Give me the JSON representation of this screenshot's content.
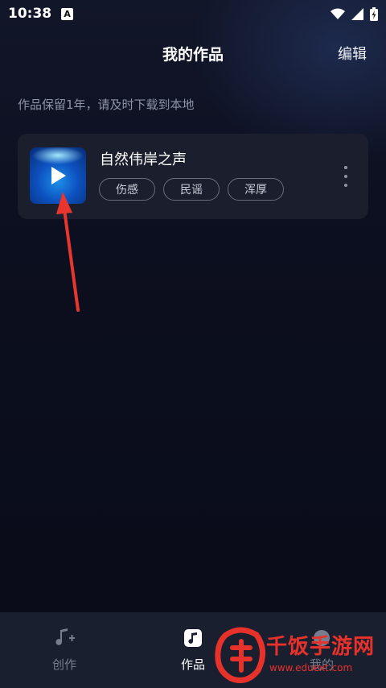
{
  "status_bar": {
    "time": "10:38",
    "badge": "A"
  },
  "header": {
    "title": "我的作品",
    "edit_label": "编辑"
  },
  "notice": "作品保留1年，请及时下载到本地",
  "work": {
    "title": "自然伟岸之声",
    "tags": [
      "伤感",
      "民谣",
      "浑厚"
    ]
  },
  "tabs": [
    {
      "label": "创作",
      "icon": "music-note-plus-icon",
      "active": false
    },
    {
      "label": "作品",
      "icon": "music-note-icon",
      "active": true
    },
    {
      "label": "我的",
      "icon": "profile-icon",
      "active": false
    }
  ],
  "watermark": {
    "title": "千饭手游网",
    "url": "www.eduext.com"
  },
  "colors": {
    "accent_red": "#e7322c",
    "card": "#1b1f2d",
    "tab_bar": "#1a1f2f"
  }
}
